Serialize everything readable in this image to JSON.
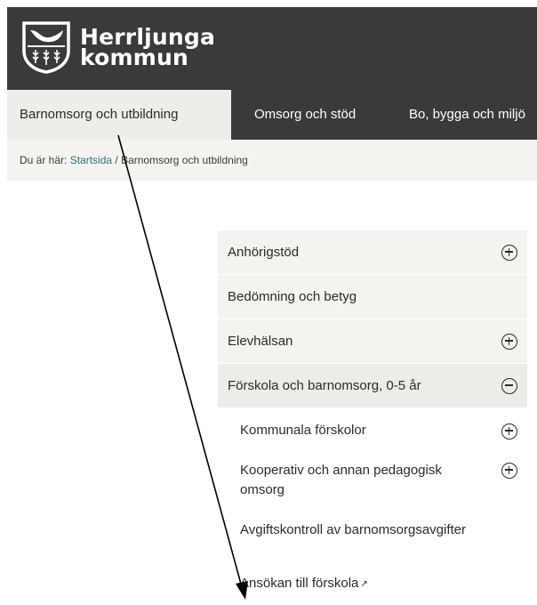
{
  "brand": {
    "line1": "Herrljunga",
    "line2": "kommun"
  },
  "nav": {
    "items": [
      {
        "label": "Barnomsorg och utbildning"
      },
      {
        "label": "Omsorg och stöd"
      },
      {
        "label": "Bo, bygga och miljö"
      }
    ]
  },
  "breadcrumb": {
    "prefix": "Du är här:",
    "home": "Startsida",
    "separator": " / ",
    "current": "Barnomsorg och utbildning"
  },
  "menu": {
    "items": [
      {
        "label": "Anhörigstöd",
        "icon": "plus-circle-icon"
      },
      {
        "label": "Bedömning och betyg"
      },
      {
        "label": "Elevhälsan",
        "icon": "plus-circle-icon"
      },
      {
        "label": "Förskola och barnomsorg, 0-5 år",
        "icon": "minus-circle-icon"
      }
    ],
    "subitems": [
      {
        "label": "Kommunala förskolor",
        "icon": "plus-circle-icon"
      },
      {
        "label": "Kooperativ och annan pedagogisk omsorg",
        "icon": "plus-circle-icon"
      },
      {
        "label": "Avgiftskontroll av barnomsorgsavgifter"
      },
      {
        "label": "Ansökan till förskola",
        "icon": "external-link-icon"
      }
    ]
  },
  "colors": {
    "header_bg": "#3a3a3a",
    "accent_bg": "#eeede8",
    "link": "#2e6f79"
  }
}
